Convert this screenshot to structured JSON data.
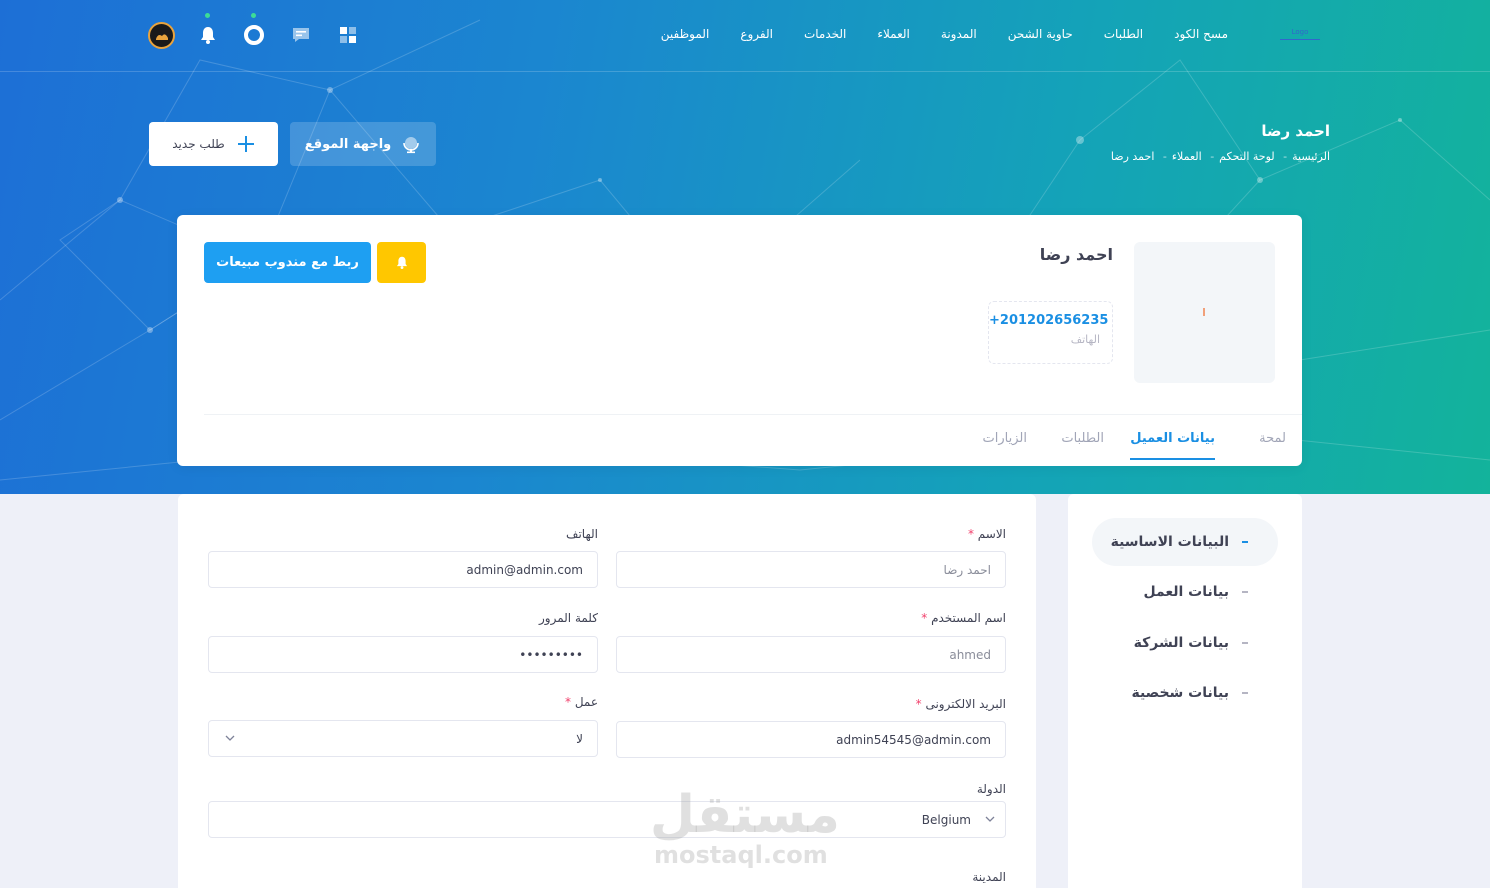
{
  "header": {
    "logo_text": "Logo",
    "nav": [
      "الموظفين",
      "الفروع",
      "الخدمات",
      "العملاء",
      "المدونة",
      "حاوية الشحن",
      "الطلبات",
      "مسح الكود"
    ]
  },
  "subheader": {
    "title": "احمد رضا",
    "breadcrumb": [
      "الرئيسية",
      "لوحة التحكم",
      "العملاء",
      "احمد رضا"
    ],
    "site_button": "واجهة الموقع",
    "new_order_button": "طلب جديد"
  },
  "profile": {
    "name": "احمد رضا",
    "phone_value": "+201202656235",
    "phone_label": "الهاتف",
    "link_button": "ربط مع مندوب مبيعات"
  },
  "tabs": [
    "لمحة",
    "بيانات العميل",
    "الطلبات",
    "الزيارات"
  ],
  "sidebar": {
    "items": [
      "البيانات الاساسية",
      "بيانات العمل",
      "بيانات الشركة",
      "بيانات شخصية"
    ]
  },
  "form": {
    "name_label": "الاسم",
    "name_placeholder": "احمد رضا",
    "phone_label": "الهاتف",
    "phone_value": "admin@admin.com",
    "username_label": "اسم المستخدم",
    "username_placeholder": "ahmed",
    "password_label": "كلمة المرور",
    "password_value": "•••••••••",
    "email_label": "البريد الالكترونى",
    "email_value": "admin54545@admin.com",
    "work_label": "عمل",
    "work_value": "لا",
    "country_label": "الدولة",
    "country_value": "Belgium",
    "city_label": "المدينة"
  },
  "watermark": {
    "arabic": "مستقل",
    "latin": "mostaql.com"
  },
  "colors": {
    "accent": "#1a8fe3",
    "warning": "#ffc700",
    "primary_button": "#1e9ff2",
    "hero_start": "#1d6fd6",
    "hero_end": "#13b39b"
  }
}
